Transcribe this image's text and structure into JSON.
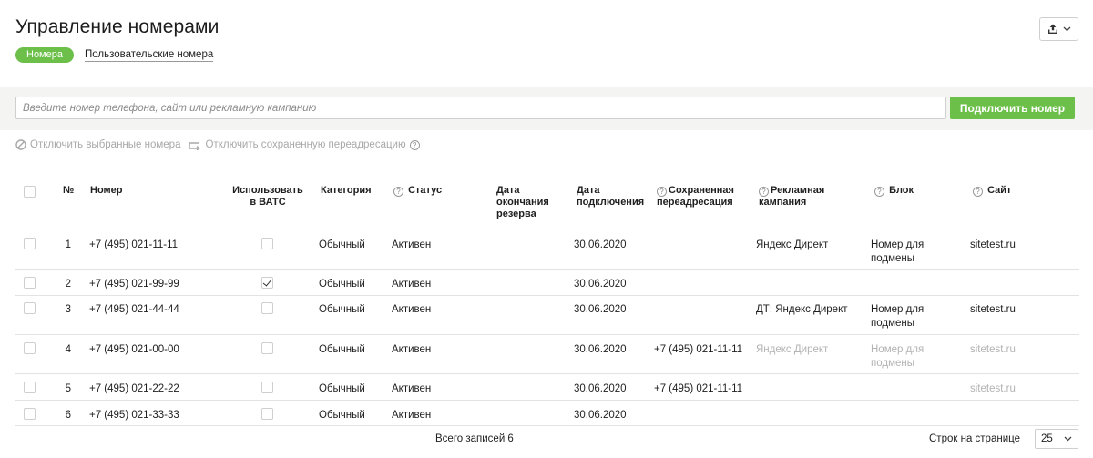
{
  "header": {
    "title": "Управление номерами",
    "export_icon": "upload-icon",
    "chevron_icon": "chevron-down-icon"
  },
  "tabs": [
    {
      "label": "Номера",
      "active": true
    },
    {
      "label": "Пользовательские номера",
      "active": false
    }
  ],
  "search": {
    "placeholder": "Введите номер телефона, сайт или рекламную кампанию",
    "value": "",
    "button": "Подключить номер"
  },
  "actions": {
    "disable_selected": "Отключить выбранные номера",
    "disable_forwarding": "Отключить сохраненную переадресацию",
    "help_glyph": "?"
  },
  "table": {
    "columns": {
      "num": "№",
      "phone": "Номер",
      "vats": [
        "Использовать",
        "в ВАТС"
      ],
      "category": "Категория",
      "status": "Статус",
      "reserve_end": [
        "Дата",
        "окончания",
        "резерва"
      ],
      "connected": [
        "Дата",
        "подключения"
      ],
      "forwarding": [
        "Сохраненная",
        "переадресация"
      ],
      "campaign": [
        "Рекламная",
        "кампания"
      ],
      "block": "Блок",
      "site": "Сайт"
    },
    "rows": [
      {
        "num": "1",
        "phone": "+7 (495) 021-11-11",
        "vats": false,
        "category": "Обычный",
        "status": "Активен",
        "reserve_end": "",
        "connected": "30.06.2020",
        "forwarding": "",
        "campaign": "Яндекс Директ",
        "block": [
          "Номер для",
          "подмены"
        ],
        "site": "sitetest.ru",
        "muted": false
      },
      {
        "num": "2",
        "phone": "+7 (495) 021-99-99",
        "vats": true,
        "category": "Обычный",
        "status": "Активен",
        "reserve_end": "",
        "connected": "30.06.2020",
        "forwarding": "",
        "campaign": "",
        "block": [
          "",
          ""
        ],
        "site": "",
        "muted": false
      },
      {
        "num": "3",
        "phone": "+7 (495) 021-44-44",
        "vats": false,
        "category": "Обычный",
        "status": "Активен",
        "reserve_end": "",
        "connected": "30.06.2020",
        "forwarding": "",
        "campaign": "ДТ: Яндекс Директ",
        "block": [
          "Номер для",
          "подмены"
        ],
        "site": "sitetest.ru",
        "muted": false
      },
      {
        "num": "4",
        "phone": "+7 (495) 021-00-00",
        "vats": false,
        "category": "Обычный",
        "status": "Активен",
        "reserve_end": "",
        "connected": "30.06.2020",
        "forwarding": "+7 (495) 021-11-11",
        "campaign": "Яндекс Директ",
        "block": [
          "Номер для",
          "подмены"
        ],
        "site": "sitetest.ru",
        "muted": true
      },
      {
        "num": "5",
        "phone": "+7 (495) 021-22-22",
        "vats": false,
        "category": "Обычный",
        "status": "Активен",
        "reserve_end": "",
        "connected": "30.06.2020",
        "forwarding": "+7 (495) 021-11-11",
        "campaign": "",
        "block": [
          "",
          ""
        ],
        "site": "sitetest.ru",
        "muted": true
      },
      {
        "num": "6",
        "phone": "+7 (495) 021-33-33",
        "vats": false,
        "category": "Обычный",
        "status": "Активен",
        "reserve_end": "",
        "connected": "30.06.2020",
        "forwarding": "",
        "campaign": "",
        "block": [
          "",
          ""
        ],
        "site": "",
        "muted": false
      }
    ]
  },
  "footer": {
    "total": "Всего записей 6",
    "rows_per_page_label": "Строк на странице",
    "rows_per_page_value": "25"
  },
  "colors": {
    "accent": "#6cc04a",
    "muted_text": "#b3b3b3"
  }
}
